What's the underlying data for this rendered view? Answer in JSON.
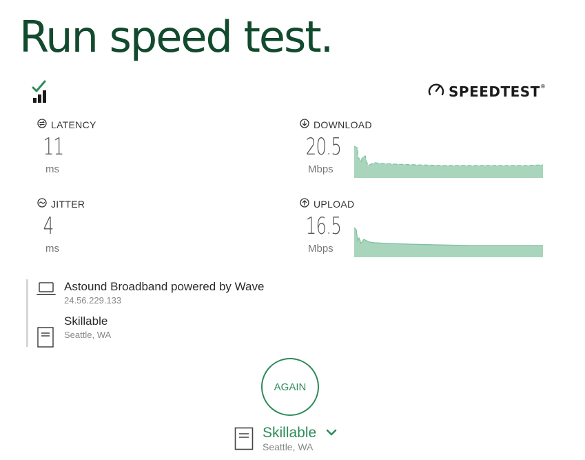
{
  "page": {
    "title": "Run speed test."
  },
  "brand": {
    "name": "SPEEDTEST",
    "mark": "®"
  },
  "metrics": {
    "latency": {
      "label": "LATENCY",
      "value": "11",
      "unit": "ms"
    },
    "jitter": {
      "label": "JITTER",
      "value": "4",
      "unit": "ms"
    },
    "download": {
      "label": "DOWNLOAD",
      "value": "20.5",
      "unit": "Mbps"
    },
    "upload": {
      "label": "UPLOAD",
      "value": "16.5",
      "unit": "Mbps"
    }
  },
  "provider": {
    "isp": {
      "name": "Astound Broadband powered by Wave",
      "ip": "24.56.229.133"
    },
    "server": {
      "name": "Skillable",
      "location": "Seattle, WA"
    }
  },
  "actions": {
    "again_label": "AGAIN"
  },
  "server_select": {
    "name": "Skillable",
    "location": "Seattle, WA"
  },
  "icons": {
    "signal": "signal-bars-icon",
    "speedometer": "speedometer-icon",
    "latency": "latency-icon",
    "jitter": "jitter-icon",
    "download": "download-arrow-icon",
    "upload": "upload-arrow-icon",
    "laptop": "laptop-icon",
    "server": "server-icon",
    "chevron": "chevron-down-icon"
  },
  "colors": {
    "title": "#124a2e",
    "accent": "#2e8b5a",
    "graph_fill": "#a8d5bc",
    "graph_line": "#6fb58f"
  }
}
